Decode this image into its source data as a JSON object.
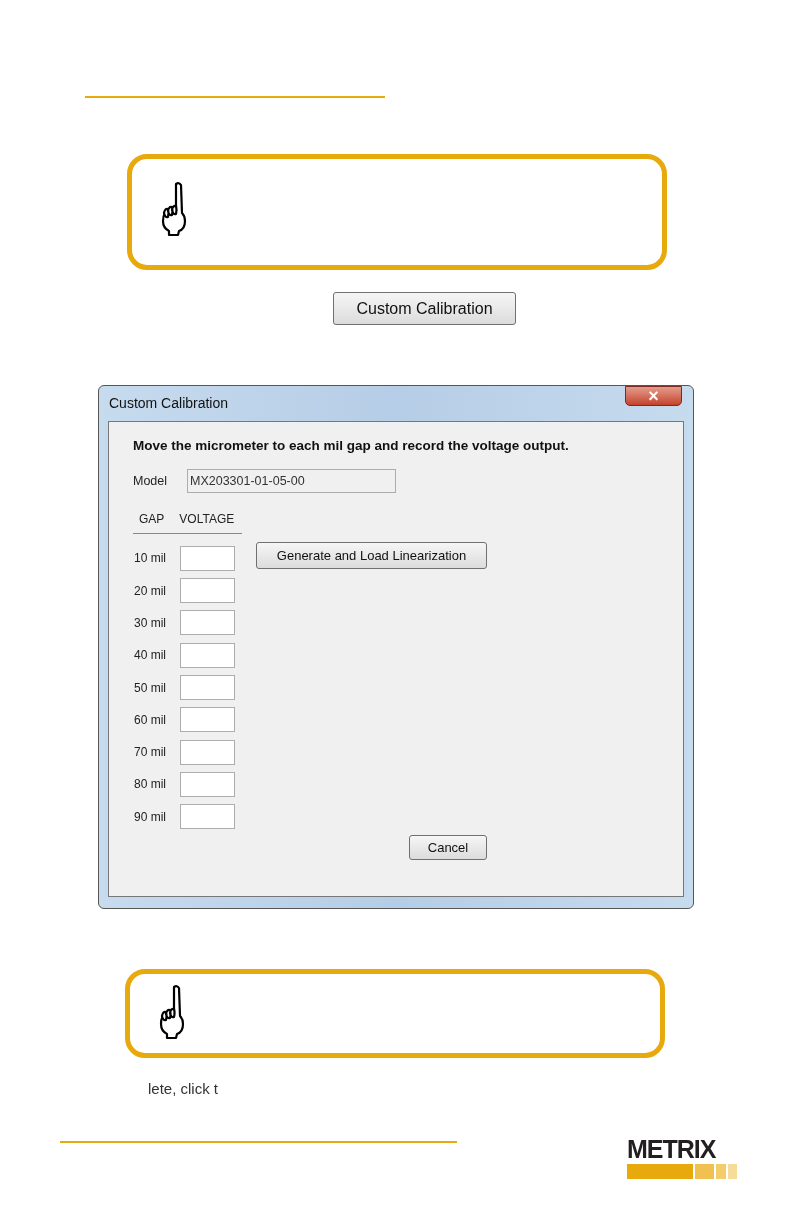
{
  "notes": [
    {
      "kind": "note"
    },
    {
      "kind": "note"
    }
  ],
  "launch_button": "Custom Calibration",
  "dialog": {
    "title": "Custom Calibration",
    "close": "×",
    "instruction": "Move the micrometer to each mil gap and record the voltage output.",
    "model_label": "Model",
    "model_value": "MX203301-01-05-00",
    "columns": [
      "GAP",
      "VOLTAGE"
    ],
    "rows": [
      {
        "gap": "10 mil"
      },
      {
        "gap": "20 mil"
      },
      {
        "gap": "30 mil"
      },
      {
        "gap": "40 mil"
      },
      {
        "gap": "50 mil"
      },
      {
        "gap": "60 mil"
      },
      {
        "gap": "70 mil"
      },
      {
        "gap": "80 mil"
      },
      {
        "gap": "90 mil"
      }
    ],
    "generate_button": "Generate and Load Linearization",
    "cancel_button": "Cancel"
  },
  "body_text": "lete, click t",
  "logo": "METRIX"
}
